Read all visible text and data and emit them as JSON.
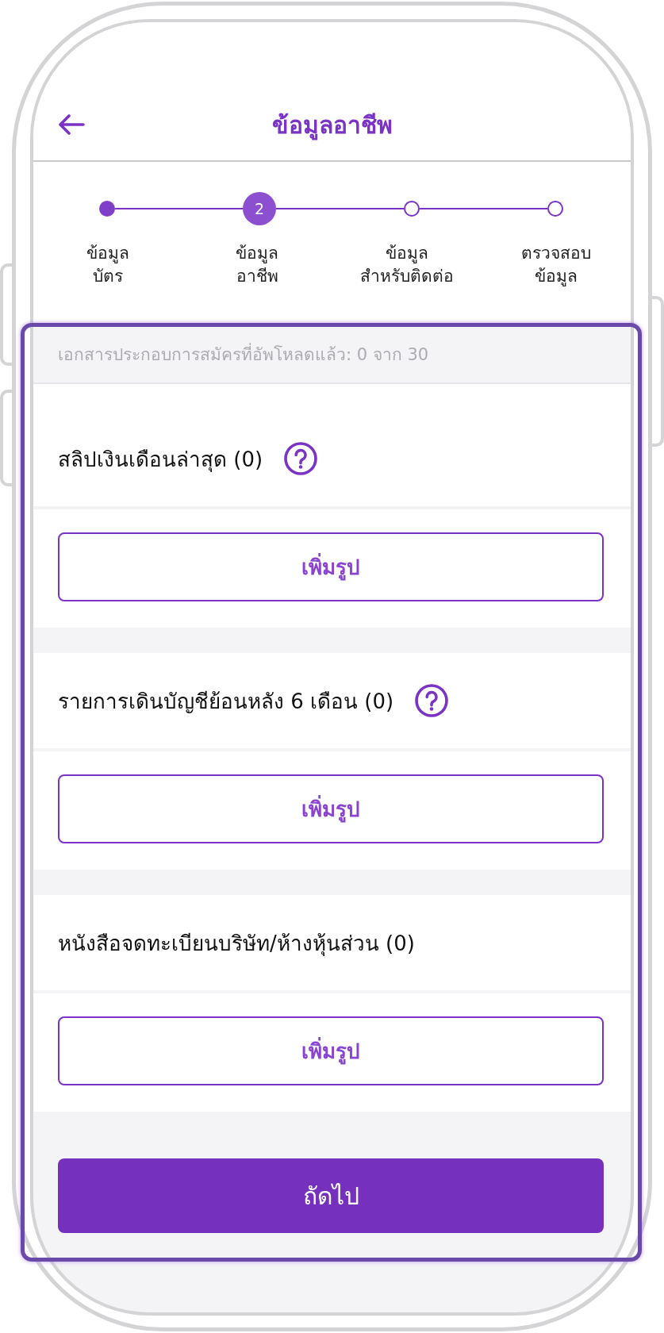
{
  "header": {
    "title": "ข้อมูลอาชีพ"
  },
  "steps": [
    {
      "label": "ข้อมูล\nบัตร",
      "completed": true,
      "selected": false
    },
    {
      "label": "ข้อมูล\nอาชีพ",
      "number": "2",
      "completed": false,
      "selected": true
    },
    {
      "label": "ข้อมูล\nสำหรับติดต่อ",
      "completed": false,
      "selected": false
    },
    {
      "label": "ตรวจสอบ\nข้อมูล",
      "completed": false,
      "selected": false
    }
  ],
  "upload_status": "เอกสารประกอบการสมัครที่อัพโหลดแล้ว: 0 จาก 30",
  "documents": [
    {
      "title": "สลิปเงินเดือนล่าสุด (0)",
      "has_help": true,
      "button": "เพิ่มรูป"
    },
    {
      "title": "รายการเดินบัญชีย้อนหลัง 6 เดือน (0)",
      "has_help": true,
      "button": "เพิ่มรูป"
    },
    {
      "title": "หนังสือจดทะเบียนบริษัท/ห้างหุ้นส่วน (0)",
      "has_help": false,
      "button": "เพิ่มรูป"
    }
  ],
  "next_button": "ถัดไป"
}
